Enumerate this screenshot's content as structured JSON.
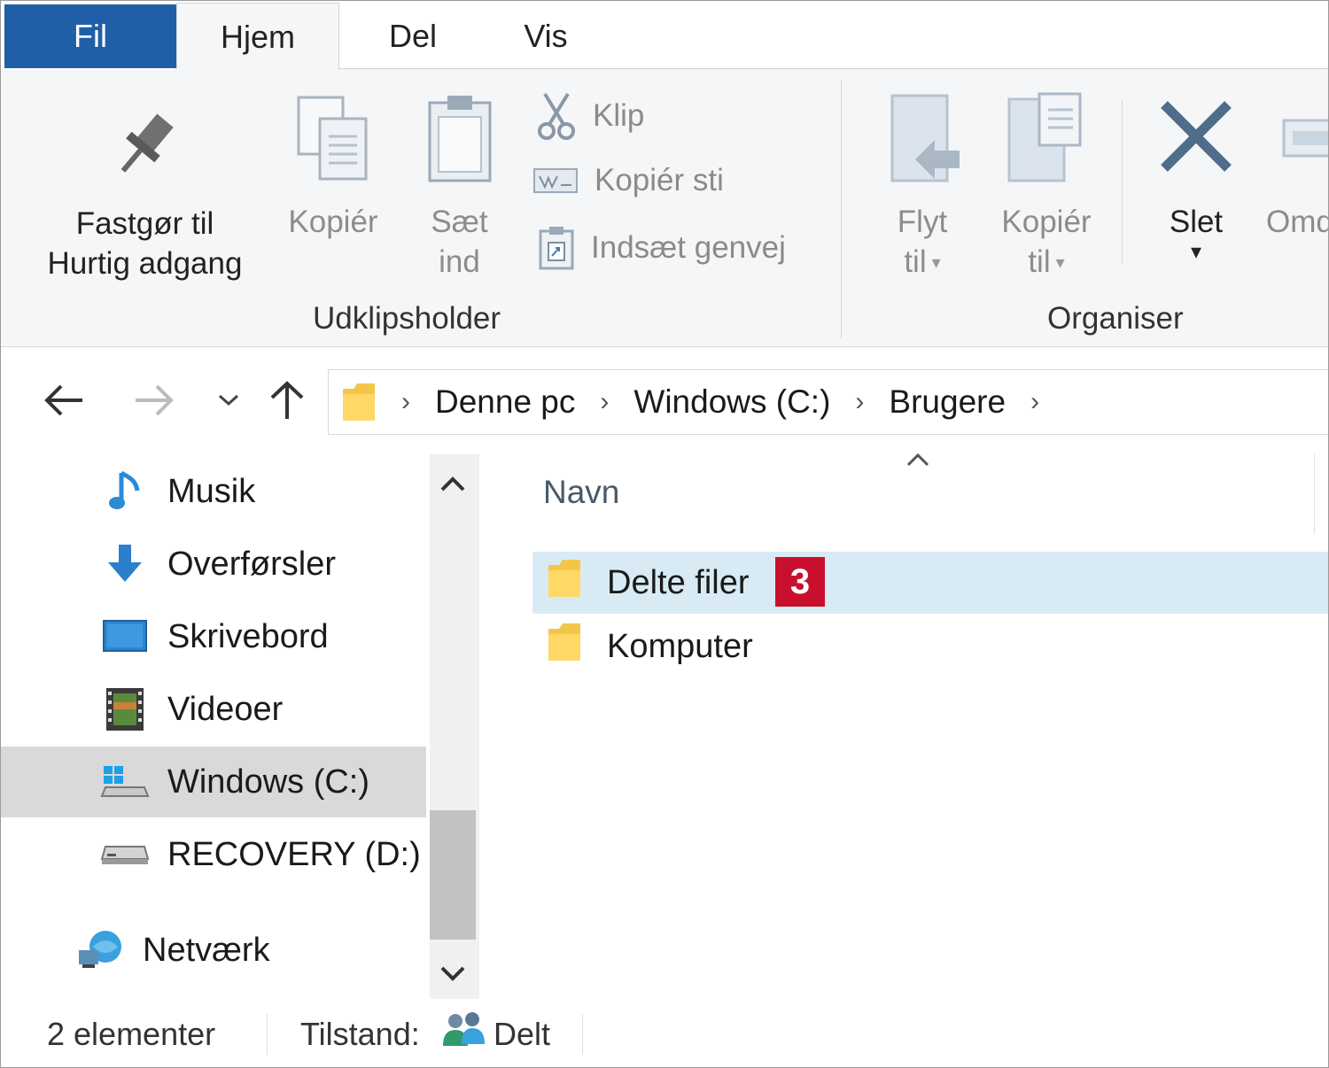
{
  "tabs": {
    "file": "Fil",
    "home": "Hjem",
    "share": "Del",
    "view": "Vis"
  },
  "ribbon": {
    "pin": {
      "line1": "Fastgør til",
      "line2": "Hurtig adgang",
      "icon": "pin-icon"
    },
    "copy": {
      "label": "Kopiér",
      "icon": "copy-icon"
    },
    "paste": {
      "line1": "Sæt",
      "line2": "ind",
      "icon": "clipboard-icon"
    },
    "cut": {
      "label": "Klip",
      "icon": "scissors-icon"
    },
    "copy_path": {
      "label": "Kopiér sti",
      "icon": "copy-path-icon"
    },
    "paste_shortcut": {
      "label": "Indsæt genvej",
      "icon": "paste-shortcut-icon"
    },
    "clipboard_group": "Udklipsholder",
    "move_to": {
      "line1": "Flyt",
      "line2": "til",
      "icon": "move-to-icon"
    },
    "copy_to": {
      "line1": "Kopiér",
      "line2": "til",
      "icon": "copy-to-icon"
    },
    "delete": {
      "label": "Slet",
      "icon": "delete-x-icon"
    },
    "rename": {
      "label": "Omd",
      "icon": "rename-icon"
    },
    "organize_group": "Organiser"
  },
  "address": {
    "crumbs": [
      "Denne pc",
      "Windows (C:)",
      "Brugere"
    ]
  },
  "nav": {
    "items": [
      {
        "label": "Musik",
        "icon": "music-icon"
      },
      {
        "label": "Overførsler",
        "icon": "download-icon"
      },
      {
        "label": "Skrivebord",
        "icon": "desktop-icon"
      },
      {
        "label": "Videoer",
        "icon": "video-icon"
      },
      {
        "label": "Windows (C:)",
        "icon": "windows-drive-icon",
        "selected": true
      },
      {
        "label": "RECOVERY (D:)",
        "icon": "drive-icon"
      },
      {
        "label": "Netværk",
        "icon": "network-icon"
      }
    ]
  },
  "content": {
    "column_name": "Navn",
    "rows": [
      {
        "name": "Delte filer",
        "selected": true,
        "badge": "3"
      },
      {
        "name": "Komputer",
        "selected": false
      }
    ]
  },
  "status": {
    "count": "2 elementer",
    "state_label": "Tilstand:",
    "state_value": "Delt"
  },
  "colors": {
    "file_tab": "#1f5fa8",
    "badge": "#c8102e",
    "selection": "#d8ebf5"
  }
}
